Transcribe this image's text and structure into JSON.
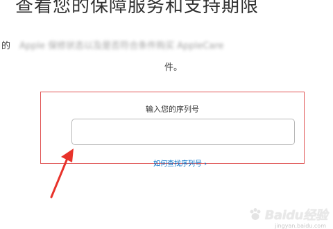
{
  "page": {
    "title": "查看您的保障服务和支持期限",
    "description_lead": "的",
    "description_blurred": "Apple 保修状态以及是否符合条件购买 AppleCare",
    "description_line2": "件。"
  },
  "serial_form": {
    "label": "输入您的序列号",
    "input_value": "",
    "input_placeholder": "",
    "help_link": "如何查找序列号 ›"
  },
  "annotation": {
    "box_color": "#e05454",
    "arrow_color": "#e8322a"
  },
  "watermark": {
    "brand": "Baidu经验",
    "url": "jingyan.baidu.com"
  }
}
